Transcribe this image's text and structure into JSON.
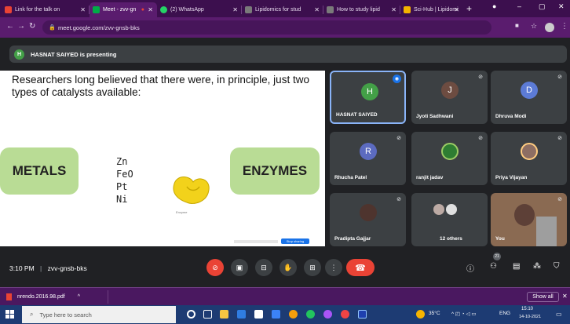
{
  "browser": {
    "tabs": [
      {
        "title": "Link for the talk on",
        "color": "#ea4335"
      },
      {
        "title": "Meet - zvv-gn",
        "color": "#00ac47"
      },
      {
        "title": "(2) WhatsApp",
        "color": "#25d366"
      },
      {
        "title": "Lipidomics for stud",
        "color": "#7a7a7a"
      },
      {
        "title": "How to study lipid",
        "color": "#7a7a7a"
      },
      {
        "title": "Sci-Hub | Lipidomi",
        "color": "#f4b400"
      }
    ],
    "url": "meet.google.com/zvv-gnsb-bks"
  },
  "meet": {
    "presenter_initial": "H",
    "presenting_banner": "HASNAT SAIYED is presenting",
    "slide": {
      "title": "Researchers long believed that there were, in principle, just two types of catalysts available:",
      "metals_label": "METALS",
      "elements": [
        "Zn",
        "FeO",
        "Pt",
        "Ni"
      ],
      "enzyme_caption": "Enzyme",
      "enzymes_label": "ENZYMES",
      "slide_button": "Stop sharing"
    },
    "participants": [
      {
        "name": "HASNAT SAIYED",
        "initial": "H",
        "color": "#43a047"
      },
      {
        "name": "Jyoti Sadhwani",
        "initial": "J",
        "color": "#6d4c41"
      },
      {
        "name": "Dhruva Modi",
        "initial": "D",
        "color": "#5c7bd6"
      },
      {
        "name": "Rhucha Patel",
        "initial": "R",
        "color": "#5c6bc0"
      },
      {
        "name": "ranjit jadav",
        "initial": "",
        "color": ""
      },
      {
        "name": "Priya Vijayan",
        "initial": "",
        "color": ""
      },
      {
        "name": "Pradipta Gajjar",
        "initial": "",
        "color": ""
      },
      {
        "name": "12 others",
        "initial": "",
        "color": ""
      },
      {
        "name": "You",
        "initial": "",
        "color": ""
      }
    ],
    "time": "3:10 PM",
    "meeting_code": "zvv-gnsb-bks",
    "people_count": "21"
  },
  "downloads": {
    "file": "nrendo.2016.98.pdf",
    "show_all": "Show all"
  },
  "taskbar": {
    "search_placeholder": "Type here to search",
    "weather": "35°C",
    "lang": "ENG",
    "time": "15:10",
    "date": "14-10-2021"
  }
}
